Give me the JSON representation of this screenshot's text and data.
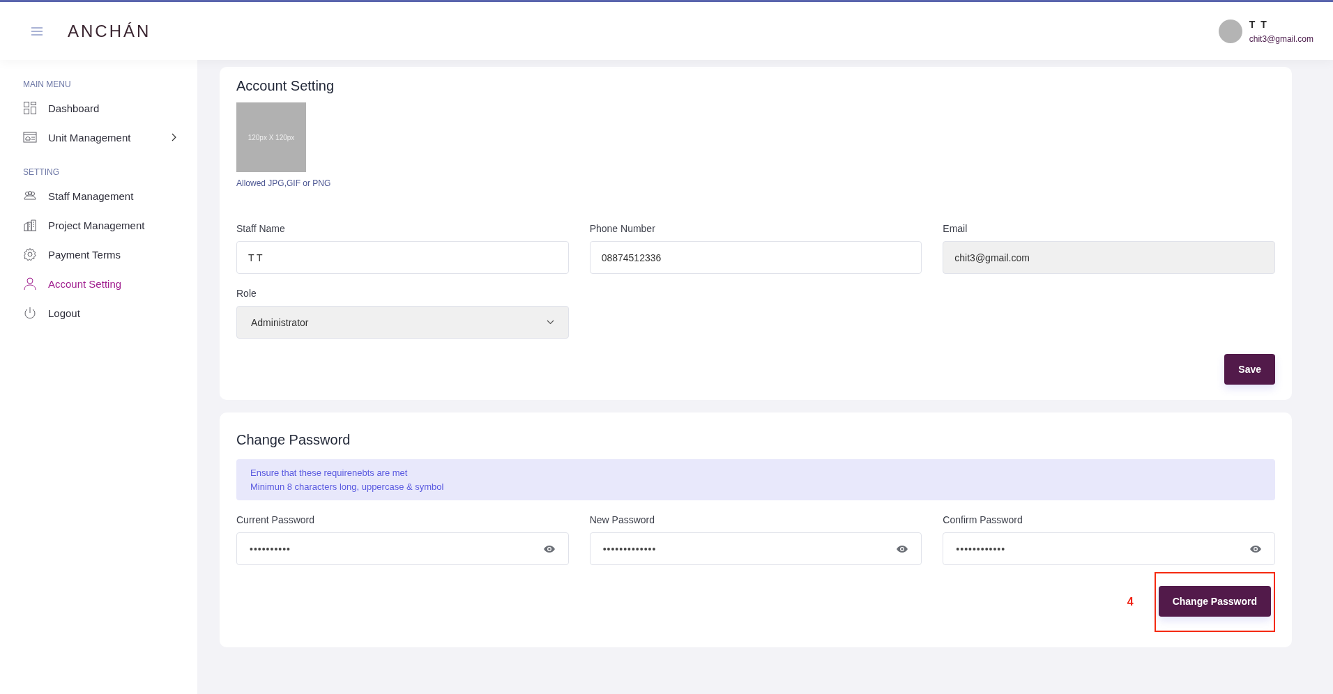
{
  "header": {
    "logo": "ANCHÁN",
    "user": {
      "name": "T T",
      "email": "chit3@gmail.com"
    }
  },
  "sidebar": {
    "sections": [
      {
        "title": "MAIN MENU",
        "items": [
          {
            "label": "Dashboard",
            "selected": false,
            "submenu": false
          },
          {
            "label": "Unit Management",
            "selected": false,
            "submenu": true
          }
        ]
      },
      {
        "title": "SETTING",
        "items": [
          {
            "label": "Staff Management",
            "selected": false,
            "submenu": false
          },
          {
            "label": "Project Management",
            "selected": false,
            "submenu": false
          },
          {
            "label": "Payment Terms",
            "selected": false,
            "submenu": false
          },
          {
            "label": "Account Setting",
            "selected": true,
            "submenu": false
          },
          {
            "label": "Logout",
            "selected": false,
            "submenu": false
          }
        ]
      }
    ]
  },
  "account": {
    "title": "Account Setting",
    "photo_text": "120px X 120px",
    "photo_hint": "Allowed JPG,GIF or PNG",
    "fields": [
      {
        "kind": "text",
        "label": "Staff Name",
        "value": "T T",
        "disabled": false
      },
      {
        "kind": "text",
        "label": "Phone Number",
        "value": "08874512336",
        "disabled": false
      },
      {
        "kind": "text",
        "label": "Email",
        "value": "chit3@gmail.com",
        "disabled": true
      },
      {
        "kind": "select",
        "label": "Role",
        "value": "Administrator",
        "disabled": true
      }
    ],
    "button": "Save"
  },
  "password": {
    "title": "Change Password",
    "notice": [
      "Ensure that these requirenebts are met",
      "Minimun 8 characters long, uppercase & symbol"
    ],
    "fields": [
      {
        "kind": "password",
        "label": "Current Password",
        "value": "••••••••••"
      },
      {
        "kind": "password",
        "label": "New Password",
        "value": "•••••••••••••"
      },
      {
        "kind": "password",
        "label": "Confirm Password",
        "value": "••••••••••••"
      }
    ],
    "button": "Change Password",
    "annotation": "4"
  }
}
